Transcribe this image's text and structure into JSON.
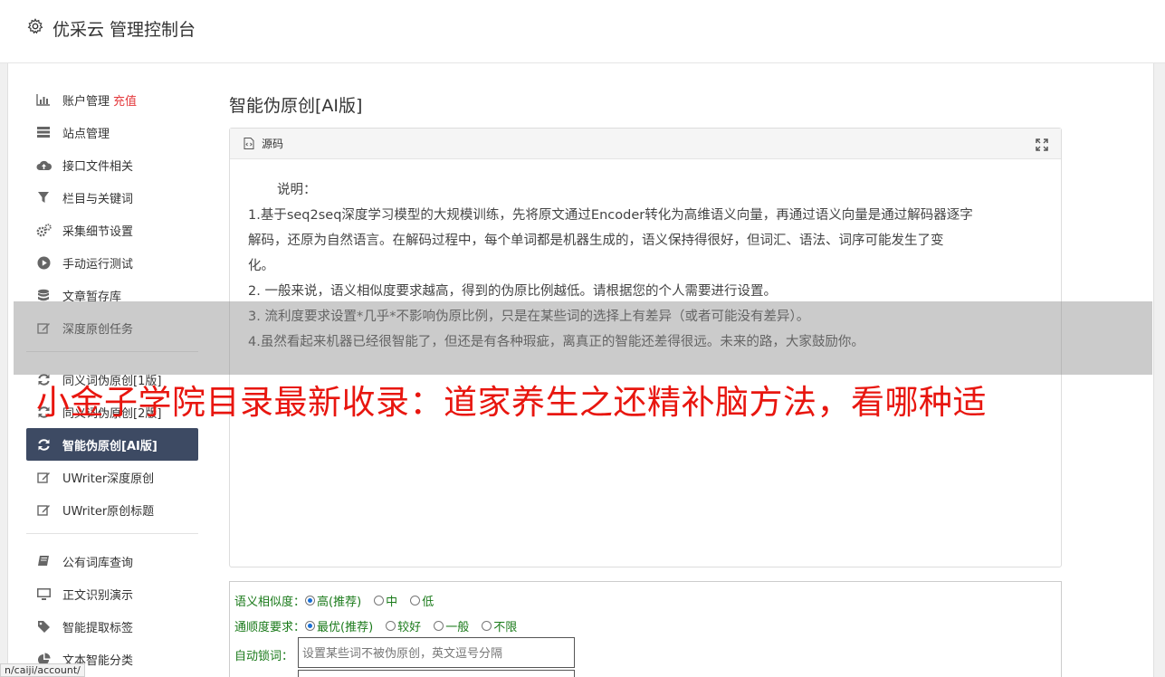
{
  "header": {
    "title": "优采云 管理控制台"
  },
  "sidebar": {
    "items": [
      {
        "label": "账户管理",
        "badge": "充值",
        "icon": "bar-chart-icon"
      },
      {
        "label": "站点管理",
        "icon": "server-icon"
      },
      {
        "label": "接口文件相关",
        "icon": "cloud-upload-icon"
      },
      {
        "label": "栏目与关键词",
        "icon": "filter-icon"
      },
      {
        "label": "采集细节设置",
        "icon": "gears-icon"
      },
      {
        "label": "手动运行测试",
        "icon": "play-circle-icon"
      },
      {
        "label": "文章暂存库",
        "icon": "database-icon"
      },
      {
        "label": "深度原创任务",
        "icon": "edit-icon"
      }
    ],
    "group2": [
      {
        "label": "同义词伪原创[1版]",
        "icon": "refresh-icon"
      },
      {
        "label": "同义词伪原创[2版]",
        "icon": "refresh-icon"
      },
      {
        "label": "智能伪原创[AI版]",
        "icon": "refresh-icon",
        "active": true
      },
      {
        "label": "UWriter深度原创",
        "icon": "edit-icon"
      },
      {
        "label": "UWriter原创标题",
        "icon": "edit-icon"
      }
    ],
    "group3": [
      {
        "label": "公有词库查询",
        "icon": "book-icon"
      },
      {
        "label": "正文识别演示",
        "icon": "monitor-icon"
      },
      {
        "label": "智能提取标签",
        "icon": "tag-icon"
      },
      {
        "label": "文本智能分类",
        "icon": "pie-chart-icon"
      }
    ]
  },
  "main": {
    "title": "智能伪原创[AI版]",
    "panel": {
      "header": "源码",
      "lines": [
        "说明：",
        "1.基于seq2seq深度学习模型的大规模训练，先将原文通过Encoder转化为高维语义向量，再通过语义向量是通过解码器逐字",
        "解码，还原为自然语言。在解码过程中，每个单词都是机器生成的，语义保持得很好，但词汇、语法、词序可能发生了变",
        "化。",
        "2. 一般来说，语义相似度要求越高，得到的伪原比例越低。请根据您的个人需要进行设置。",
        "3. 流利度要求设置*几乎*不影响伪原比例，只是在某些词的选择上有差异（或者可能没有差异）。",
        "4.虽然看起来机器已经很智能了，但还是有各种瑕疵，离真正的智能还差得很远。未来的路，大家鼓励你。"
      ]
    },
    "options": {
      "similarity_label": "语义相似度：",
      "similarity": [
        "高(推荐)",
        "中",
        "低"
      ],
      "fluency_label": "通顺度要求：",
      "fluency": [
        "最优(推荐)",
        "较好",
        "一般",
        "不限"
      ],
      "lock_label": "自动锁词：",
      "lock_placeholder": "设置某些词不被伪原创，英文逗号分隔"
    }
  },
  "overlay": {
    "text": "小金子学院目录最新收录：道家养生之还精补脑方法，看哪种适"
  },
  "statusbar": {
    "url": "n/caiji/account/"
  },
  "colors": {
    "active_nav": "#3d4a63",
    "accent_red": "#e8160f",
    "option_green": "#1a7a1a"
  }
}
